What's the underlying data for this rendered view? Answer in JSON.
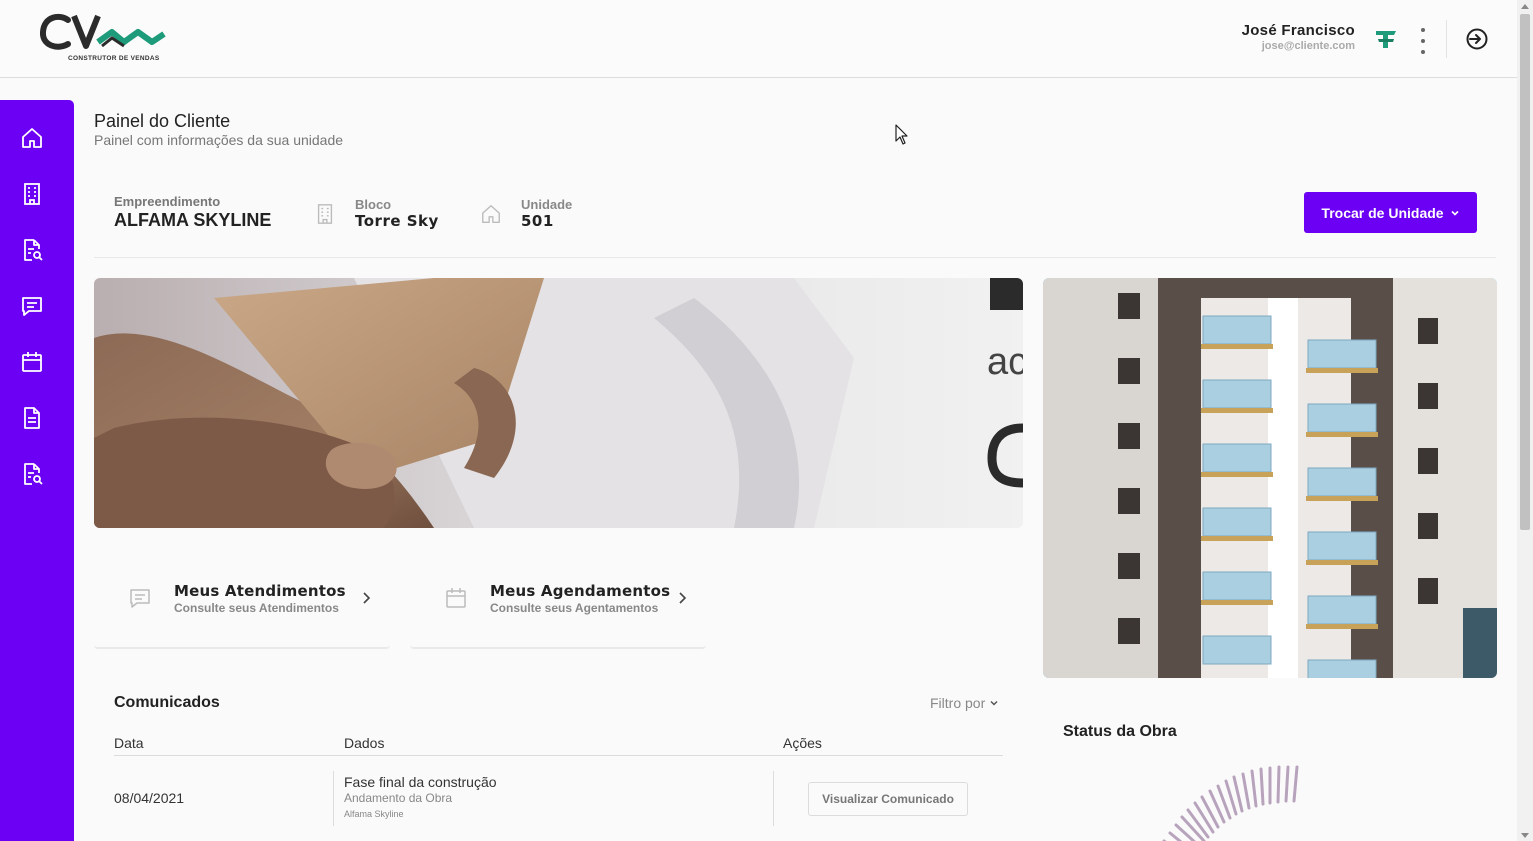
{
  "header": {
    "logo_text": "CONSTRUTOR DE VENDAS",
    "user_name": "José Francisco",
    "user_email": "jose@cliente.com"
  },
  "sidebar": {
    "items": [
      {
        "icon": "home-icon"
      },
      {
        "icon": "building-icon"
      },
      {
        "icon": "document-search-icon"
      },
      {
        "icon": "chat-icon"
      },
      {
        "icon": "calendar-icon"
      },
      {
        "icon": "document-icon"
      },
      {
        "icon": "document-search-icon"
      }
    ]
  },
  "page": {
    "title": "Painel do Cliente",
    "subtitle": "Painel com informações da sua unidade"
  },
  "unit": {
    "empreendimento_label": "Empreendimento",
    "empreendimento_value": "ALFAMA SKYLINE",
    "bloco_label": "Bloco",
    "bloco_value": "Torre Sky",
    "unidade_label": "Unidade",
    "unidade_value": "501",
    "switch_button": "Trocar de Unidade"
  },
  "quick_cards": [
    {
      "title": "Meus Atendimentos",
      "subtitle": "Consulte seus Atendimentos",
      "icon": "chat-icon"
    },
    {
      "title": "Meus Agendamentos",
      "subtitle": "Consulte seus Agentamentos",
      "icon": "calendar-icon"
    }
  ],
  "comunicados": {
    "title": "Comunicados",
    "filter_label": "Filtro por",
    "columns": [
      "Data",
      "Dados",
      "Ações"
    ],
    "rows": [
      {
        "date": "08/04/2021",
        "title": "Fase final da construção",
        "category": "Andamento da Obra",
        "project": "Alfama Skyline",
        "action": "Visualizar Comunicado"
      }
    ]
  },
  "status": {
    "title": "Status da Obra"
  },
  "colors": {
    "primary": "#6b00f5",
    "brand_green": "#1d9b7a",
    "brand_dark": "#2b2b2b"
  }
}
